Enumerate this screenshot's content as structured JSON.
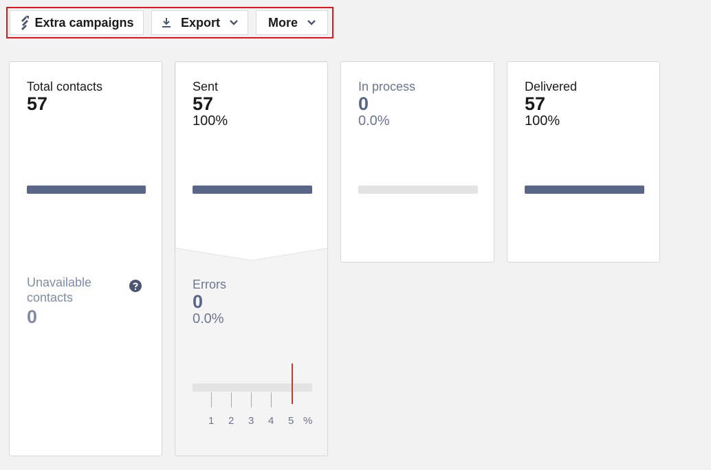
{
  "toolbar": {
    "extra_campaigns": "Extra campaigns",
    "export": "Export",
    "more": "More"
  },
  "cards": {
    "total": {
      "label": "Total contacts",
      "value": "57",
      "fill": 1.0
    },
    "unavailable": {
      "label_line1": "Unavailable",
      "label_line2": "contacts",
      "value": "0"
    },
    "sent": {
      "label": "Sent",
      "value": "57",
      "percent": "100%",
      "fill": 1.0
    },
    "errors": {
      "label": "Errors",
      "value": "0",
      "percent": "0.0%",
      "scale_ticks": [
        "1",
        "2",
        "3",
        "4",
        "5"
      ],
      "unit": "%",
      "threshold": 5
    },
    "in_process": {
      "label": "In process",
      "value": "0",
      "percent": "0.0%",
      "fill": 0.0
    },
    "delivered": {
      "label": "Delivered",
      "value": "57",
      "percent": "100%",
      "fill": 1.0
    }
  },
  "colors": {
    "accent": "#5a6688",
    "threshold": "#c0392b",
    "highlight": "#e8121c"
  }
}
